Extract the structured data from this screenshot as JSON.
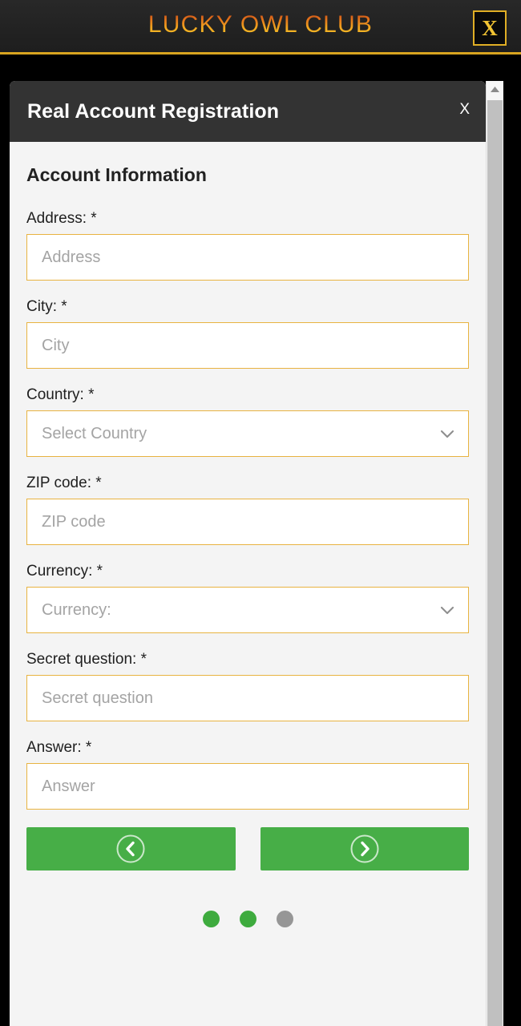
{
  "site_header": {
    "brand": "LUCKY OWL CLUB",
    "close_label": "X",
    "accent_gold": "#e0ae25"
  },
  "modal": {
    "title": "Real Account Registration",
    "close_label": "X",
    "section_title": "Account Information",
    "fields": [
      {
        "label": "Address: *",
        "placeholder": "Address",
        "type": "text",
        "name": "address"
      },
      {
        "label": "City: *",
        "placeholder": "City",
        "type": "text",
        "name": "city"
      },
      {
        "label": "Country: *",
        "placeholder": "Select Country",
        "type": "select",
        "name": "country"
      },
      {
        "label": "ZIP code: *",
        "placeholder": "ZIP code",
        "type": "text",
        "name": "zip-code"
      },
      {
        "label": "Currency: *",
        "placeholder": "Currency:",
        "type": "select",
        "name": "currency"
      },
      {
        "label": "Secret question: *",
        "placeholder": "Secret question",
        "type": "text",
        "name": "secret-question"
      },
      {
        "label": "Answer: *",
        "placeholder": "Answer",
        "type": "text",
        "name": "answer"
      }
    ],
    "navigation": {
      "previous_icon": "chevron-left-circle-icon",
      "next_icon": "chevron-right-circle-icon",
      "button_color": "#47ae47"
    },
    "steps": {
      "total": 3,
      "states": [
        "active",
        "active",
        "inactive"
      ],
      "active_color": "#3eab3e",
      "inactive_color": "#969696"
    }
  },
  "scrollbar": {
    "up_arrow_icon": "triangle-up-icon",
    "thumb_color": "#c0c0c0"
  }
}
